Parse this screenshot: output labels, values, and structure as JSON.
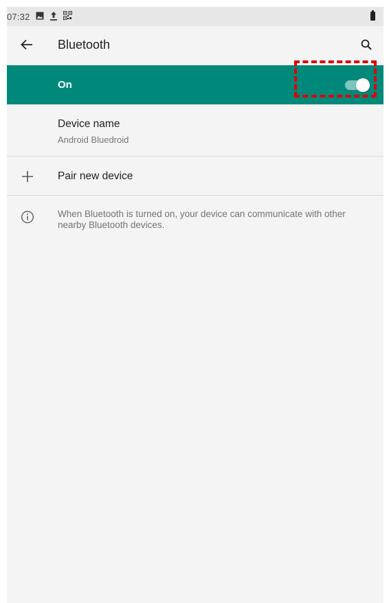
{
  "status_bar": {
    "time": "07:32",
    "icons": [
      "image-icon",
      "upload-icon",
      "qr-code-icon",
      "battery-icon"
    ]
  },
  "app_bar": {
    "title": "Bluetooth",
    "back_icon": "arrow-back-icon",
    "search_icon": "search-icon"
  },
  "master_switch": {
    "label": "On",
    "checked": true,
    "accent_color": "#00897b"
  },
  "device_name": {
    "title": "Device name",
    "value": "Android Bluedroid"
  },
  "pair_new_device": {
    "label": "Pair new device",
    "icon": "plus-icon"
  },
  "info": {
    "icon": "info-icon",
    "text": "When Bluetooth is turned on, your device can communicate with other nearby Bluetooth devices."
  },
  "annotation": {
    "highlight_color": "#e00000"
  }
}
